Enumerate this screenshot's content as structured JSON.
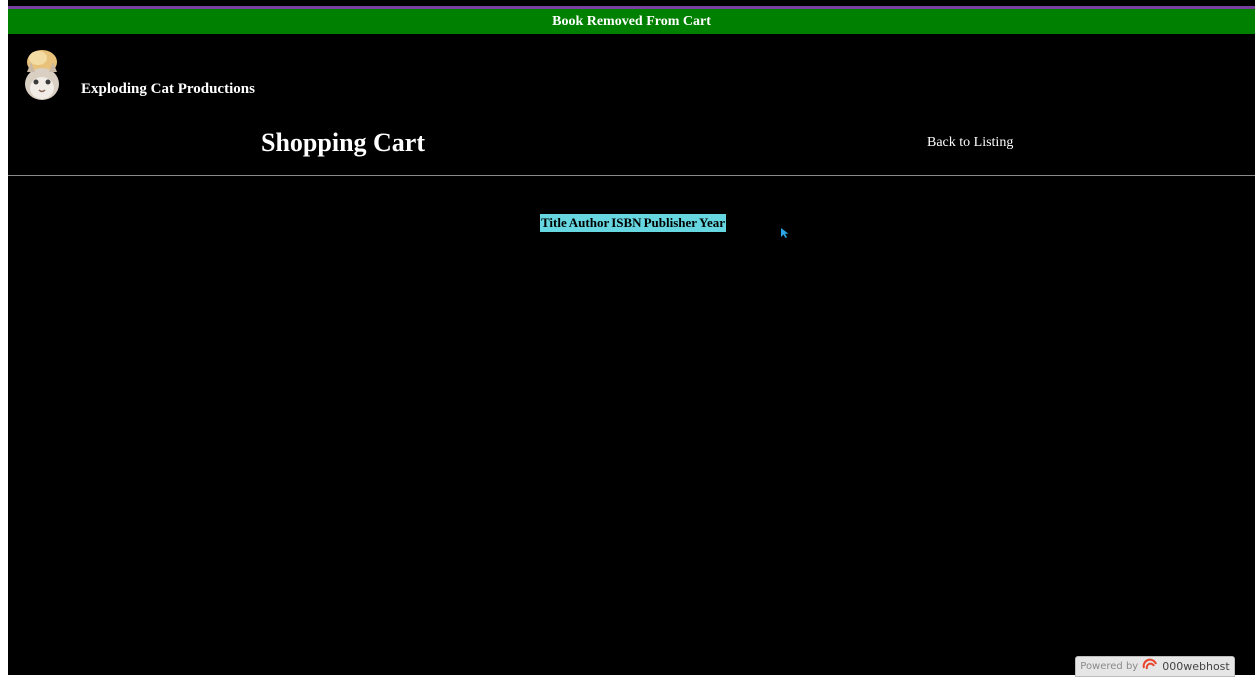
{
  "banner": {
    "message": "Book Removed From Cart",
    "color": "#008000"
  },
  "header": {
    "company_name": "Exploding Cat Productions",
    "logo_icon": "cat-logo-icon",
    "page_title": "Shopping Cart",
    "back_link": "Back to Listing"
  },
  "cart_table": {
    "header_color": "#66d6e0",
    "columns": [
      "Title",
      "Author",
      "ISBN",
      "Publisher",
      "Year"
    ]
  },
  "footer": {
    "powered_by": "Powered by",
    "host_brand": "000webhost",
    "host_icon": "webhost-logo-icon"
  }
}
